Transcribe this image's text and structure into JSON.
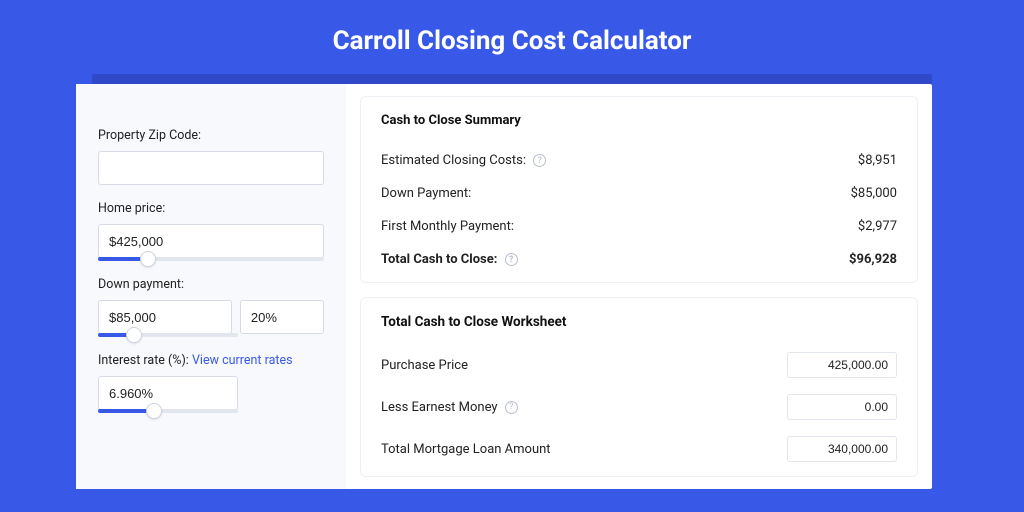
{
  "title": "Carroll Closing Cost Calculator",
  "form": {
    "zip": {
      "label": "Property Zip Code:",
      "value": ""
    },
    "home_price": {
      "label": "Home price:",
      "value": "$425,000",
      "slider_pct": 22
    },
    "down_payment": {
      "label": "Down payment:",
      "value": "$85,000",
      "pct_value": "20%",
      "slider_pct": 22
    },
    "interest_rate": {
      "label": "Interest rate (%):",
      "link_text": "View current rates",
      "value": "6.960%",
      "slider_pct": 30
    }
  },
  "summary": {
    "title": "Cash to Close Summary",
    "rows": [
      {
        "label": "Estimated Closing Costs:",
        "help": true,
        "value": "$8,951",
        "bold": false
      },
      {
        "label": "Down Payment:",
        "help": false,
        "value": "$85,000",
        "bold": false
      },
      {
        "label": "First Monthly Payment:",
        "help": false,
        "value": "$2,977",
        "bold": false
      },
      {
        "label": "Total Cash to Close:",
        "help": true,
        "value": "$96,928",
        "bold": true
      }
    ]
  },
  "worksheet": {
    "title": "Total Cash to Close Worksheet",
    "rows": [
      {
        "label": "Purchase Price",
        "help": false,
        "value": "425,000.00"
      },
      {
        "label": "Less Earnest Money",
        "help": true,
        "value": "0.00"
      },
      {
        "label": "Total Mortgage Loan Amount",
        "help": false,
        "value": "340,000.00"
      }
    ]
  }
}
